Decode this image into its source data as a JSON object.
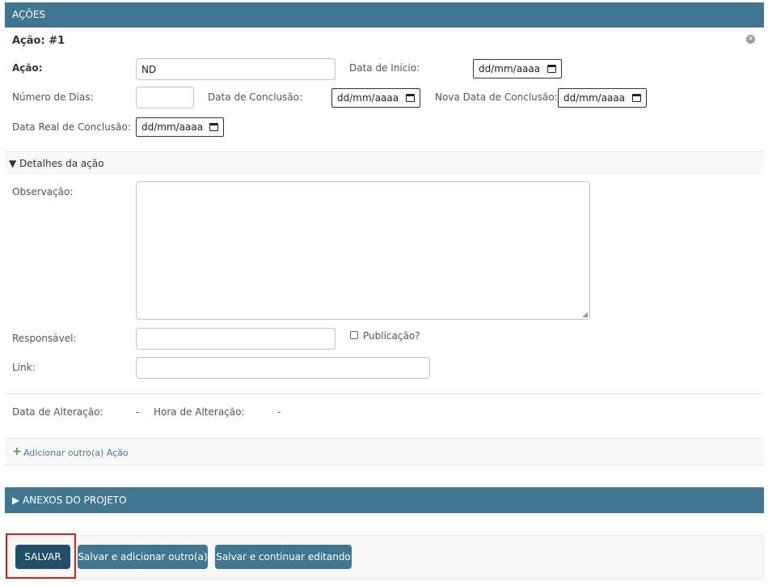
{
  "acoes_header": "AÇÕES",
  "inline_title": "Ação: #1",
  "fields": {
    "acao_label": "Ação:",
    "acao_value": "ND",
    "data_inicio_label": "Data de Início:",
    "data_inicio_value": "dd/mm/aaaa",
    "numero_dias_label": "Número de Dias:",
    "data_conclusao_label": "Data de Conclusão:",
    "data_conclusao_value": "dd/mm/aaaa",
    "nova_data_label": "Nova Data de Conclusão:",
    "nova_data_value": "dd/mm/aaaa",
    "data_real_label": "Data Real de Conclusão:",
    "data_real_value": "dd/mm/aaaa"
  },
  "details": {
    "toggle_label": "▼ Detalhes da ação",
    "observacao_label": "Observação:",
    "responsavel_label": "Responsável:",
    "publicacao_label": "Publicação?",
    "link_label": "Link:"
  },
  "meta": {
    "data_alteracao_label": "Data de Alteração:",
    "data_alteracao_value": "-",
    "hora_alteracao_label": "Hora de Alteração:",
    "hora_alteracao_value": "-"
  },
  "add_another_label": "Adicionar outro(a) Ação",
  "anexos_header": "▶ ANEXOS DO PROJETO",
  "buttons": {
    "save": "SALVAR",
    "save_add": "Salvar e adicionar outro(a)",
    "save_continue": "Salvar e continuar editando"
  },
  "colors": {
    "header": "#417690",
    "save_button": "#205067",
    "highlight": "#e02020",
    "add_icon": "#5b9d2c"
  }
}
